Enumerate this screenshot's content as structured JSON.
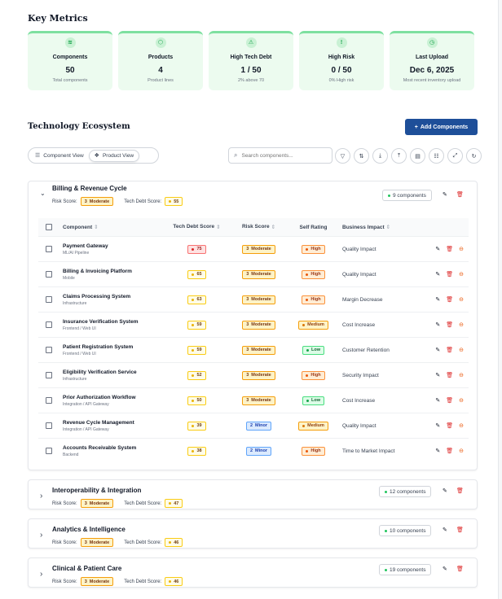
{
  "metrics_title": "Key Metrics",
  "metrics": [
    {
      "icon": "layers-icon",
      "glyph": "≋",
      "label": "Components",
      "value": "50",
      "sub": "Total components"
    },
    {
      "icon": "cube-icon",
      "glyph": "⬡",
      "label": "Products",
      "value": "4",
      "sub": "Product lines"
    },
    {
      "icon": "warning-icon",
      "glyph": "⚠",
      "label": "High Tech Debt",
      "value": "1 / 50",
      "sub": "2% above 70"
    },
    {
      "icon": "alert-circle-icon",
      "glyph": "!",
      "label": "High Risk",
      "value": "0 / 50",
      "sub": "0% High risk"
    },
    {
      "icon": "clock-icon",
      "glyph": "◷",
      "label": "Last Upload",
      "value": "Dec 6, 2025",
      "sub": "Most recent inventory upload"
    }
  ],
  "ecosystem_title": "Technology Ecosystem",
  "add_button": "Add Components",
  "views": {
    "component": "Component View",
    "product": "Product View"
  },
  "search": {
    "placeholder": "Search components..."
  },
  "toolbar_icons": [
    "filter-icon",
    "sort-icon",
    "download-icon",
    "upload-icon",
    "file-icon",
    "settings-sliders-icon",
    "expand-icon",
    "refresh-icon"
  ],
  "labels": {
    "risk_score": "Risk Score:",
    "tech_debt_score": "Tech Debt Score:"
  },
  "columns": {
    "component": "Component",
    "tech_debt": "Tech Debt Score",
    "risk": "Risk Score",
    "self_rating": "Self Rating",
    "impact": "Business Impact"
  },
  "groups": [
    {
      "title": "Billing & Revenue Cycle",
      "risk_num": "3",
      "risk_label": "Moderate",
      "tech_debt": "55",
      "count": "9 components",
      "expanded": true,
      "rows": [
        {
          "name": "Payment Gateway",
          "sub": "ML/AI Pipeline",
          "td": "75",
          "td_level": "red",
          "risk_num": "3",
          "risk_label": "Moderate",
          "risk_level": "mod",
          "self": "High",
          "self_level": "high",
          "impact": "Quality Impact"
        },
        {
          "name": "Billing & Invoicing Platform",
          "sub": "Mobile",
          "td": "65",
          "td_level": "yellow",
          "risk_num": "3",
          "risk_label": "Moderate",
          "risk_level": "mod",
          "self": "High",
          "self_level": "high",
          "impact": "Quality Impact"
        },
        {
          "name": "Claims Processing System",
          "sub": "Infrastructure",
          "td": "63",
          "td_level": "yellow",
          "risk_num": "3",
          "risk_label": "Moderate",
          "risk_level": "mod",
          "self": "High",
          "self_level": "high",
          "impact": "Margin Decrease"
        },
        {
          "name": "Insurance Verification System",
          "sub": "Frontend / Web UI",
          "td": "59",
          "td_level": "yellow",
          "risk_num": "3",
          "risk_label": "Moderate",
          "risk_level": "mod",
          "self": "Medium",
          "self_level": "med",
          "impact": "Cost Increase"
        },
        {
          "name": "Patient Registration System",
          "sub": "Frontend / Web UI",
          "td": "59",
          "td_level": "yellow",
          "risk_num": "3",
          "risk_label": "Moderate",
          "risk_level": "mod",
          "self": "Low",
          "self_level": "low",
          "impact": "Customer Retention"
        },
        {
          "name": "Eligibility Verification Service",
          "sub": "Infrastructure",
          "td": "52",
          "td_level": "yellow",
          "risk_num": "3",
          "risk_label": "Moderate",
          "risk_level": "mod",
          "self": "High",
          "self_level": "high",
          "impact": "Security Impact"
        },
        {
          "name": "Prior Authorization Workflow",
          "sub": "Integration / API Gateway",
          "td": "50",
          "td_level": "yellow",
          "risk_num": "3",
          "risk_label": "Moderate",
          "risk_level": "mod",
          "self": "Low",
          "self_level": "low",
          "impact": "Cost Increase"
        },
        {
          "name": "Revenue Cycle Management",
          "sub": "Integration / API Gateway",
          "td": "39",
          "td_level": "yellow",
          "risk_num": "2",
          "risk_label": "Minor",
          "risk_level": "minor",
          "self": "Medium",
          "self_level": "med",
          "impact": "Quality Impact"
        },
        {
          "name": "Accounts Receivable System",
          "sub": "Backend",
          "td": "38",
          "td_level": "yellow",
          "risk_num": "2",
          "risk_label": "Minor",
          "risk_level": "minor",
          "self": "High",
          "self_level": "high",
          "impact": "Time to Market Impact"
        }
      ]
    },
    {
      "title": "Interoperability & Integration",
      "risk_num": "3",
      "risk_label": "Moderate",
      "tech_debt": "47",
      "count": "12 components",
      "expanded": false,
      "rows": []
    },
    {
      "title": "Analytics & Intelligence",
      "risk_num": "3",
      "risk_label": "Moderate",
      "tech_debt": "46",
      "count": "10 components",
      "expanded": false,
      "rows": []
    },
    {
      "title": "Clinical & Patient Care",
      "risk_num": "3",
      "risk_label": "Moderate",
      "tech_debt": "46",
      "count": "19 components",
      "expanded": false,
      "rows": []
    }
  ],
  "colors": {
    "accent": "#1e4f99",
    "card_bg": "#ecfbef",
    "card_top": "#7ee0a0",
    "danger": "#dc2626"
  }
}
